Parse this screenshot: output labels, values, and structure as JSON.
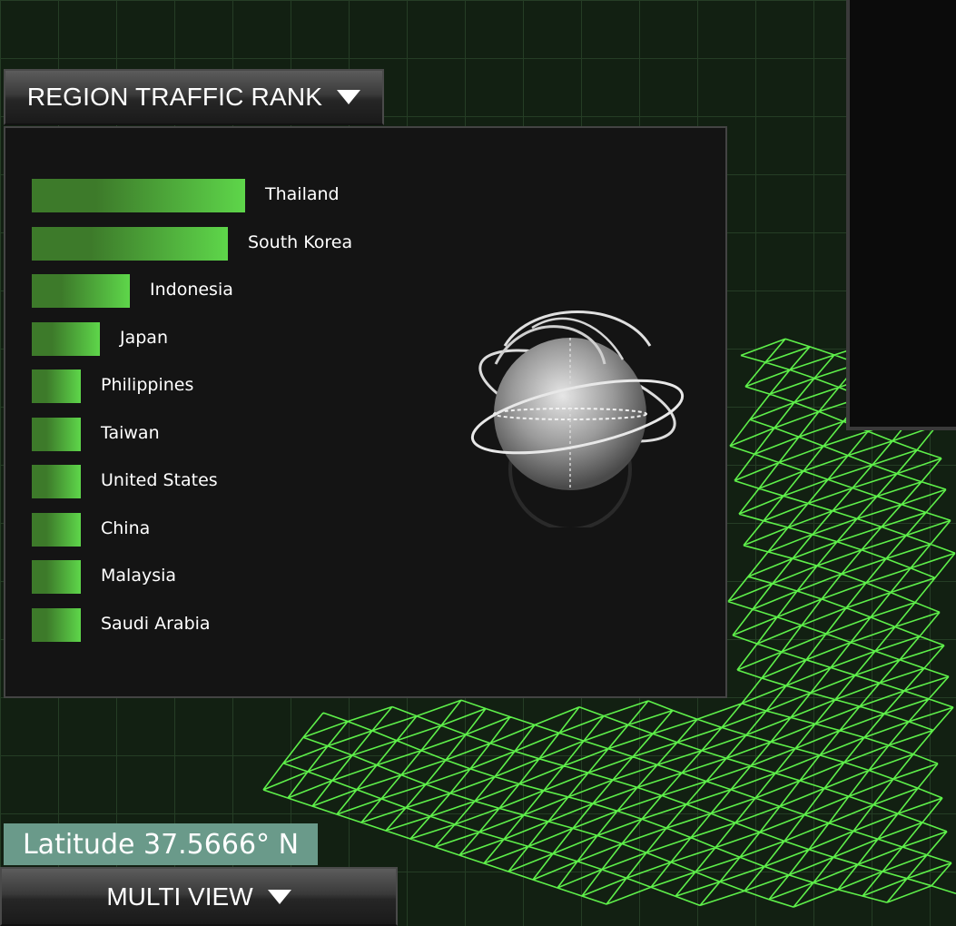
{
  "rank_panel": {
    "title": "REGION TRAFFIC RANK",
    "items": [
      {
        "label": "Thailand",
        "value": 1.0
      },
      {
        "label": "South Korea",
        "value": 0.92
      },
      {
        "label": "Indonesia",
        "value": 0.46
      },
      {
        "label": "Japan",
        "value": 0.32
      },
      {
        "label": "Philippines",
        "value": 0.23
      },
      {
        "label": "Taiwan",
        "value": 0.23
      },
      {
        "label": "United States",
        "value": 0.23
      },
      {
        "label": "China",
        "value": 0.23
      },
      {
        "label": "Malaysia",
        "value": 0.23
      },
      {
        "label": "Saudi Arabia",
        "value": 0.23
      }
    ]
  },
  "latitude_readout": "Latitude 37.5666° N",
  "view_menu": {
    "label": "MULTI VIEW"
  },
  "colors": {
    "bar_dark": "#3d7a2a",
    "bar_light": "#5ed64a",
    "mesh": "#5ef04a",
    "panel": "#141414",
    "latitude_bg": "#6a9a8a"
  }
}
